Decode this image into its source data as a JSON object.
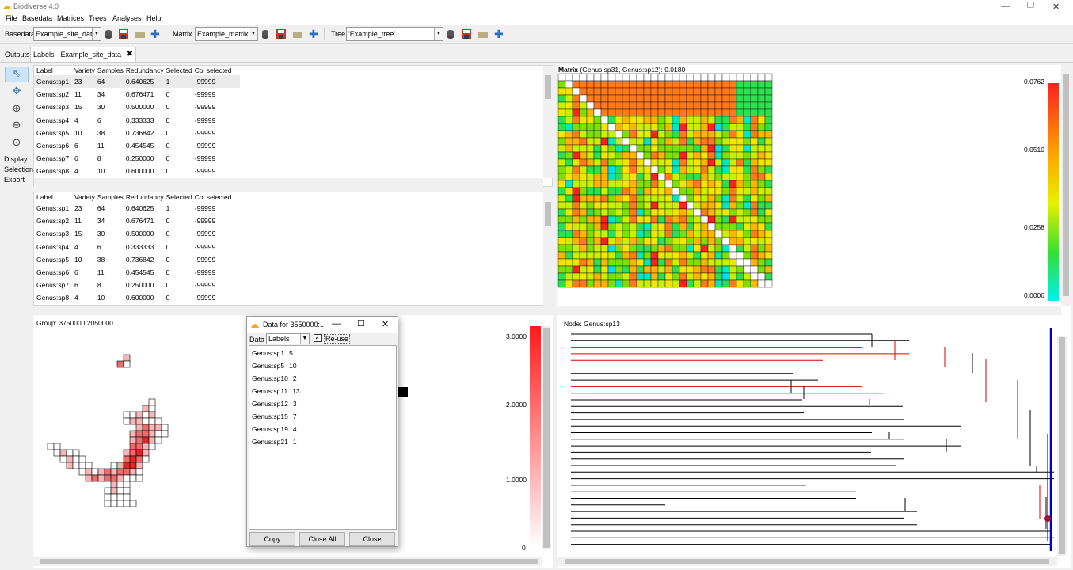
{
  "app": {
    "title": "Biodiverse 4.0"
  },
  "menu": [
    "File",
    "Basedata",
    "Matrices",
    "Trees",
    "Analyses",
    "Help"
  ],
  "toolbar": {
    "basedata_label": "Basedata",
    "basedata_value": "Example_site_data",
    "matrix_label": "Matrix",
    "matrix_value": "Example_matrix",
    "tree_label": "Tree",
    "tree_value": "'Example_tree'"
  },
  "tabs": [
    "Outputs",
    "Labels - Example_site_data"
  ],
  "sidebar": {
    "display": "Display",
    "selection": "Selection",
    "export": "Export"
  },
  "labels_table": {
    "columns": [
      "Label",
      "Variety",
      "Samples",
      "Redundancy",
      "Selected",
      "Col selected"
    ],
    "rows": [
      [
        "Genus:sp1",
        "23",
        "64",
        "0.640625",
        "1",
        "-99999"
      ],
      [
        "Genus:sp2",
        "11",
        "34",
        "0.676471",
        "0",
        "-99999"
      ],
      [
        "Genus:sp3",
        "15",
        "30",
        "0.500000",
        "0",
        "-99999"
      ],
      [
        "Genus:sp4",
        "4",
        "6",
        "0.333333",
        "0",
        "-99999"
      ],
      [
        "Genus:sp5",
        "10",
        "38",
        "0.736842",
        "0",
        "-99999"
      ],
      [
        "Genus:sp6",
        "6",
        "11",
        "0.454545",
        "0",
        "-99999"
      ],
      [
        "Genus:sp7",
        "6",
        "8",
        "0.250000",
        "0",
        "-99999"
      ],
      [
        "Genus:sp8",
        "4",
        "10",
        "0.600000",
        "0",
        "-99999"
      ]
    ]
  },
  "matrix": {
    "title": "Matrix",
    "caption": "(Genus:sp31, Genus:sp12): 0.0180",
    "legend": [
      "0.0762",
      "0.0510",
      "0.0258",
      "0.0006"
    ]
  },
  "map": {
    "group": "Group: 3750000:2050000",
    "legend": [
      "3.0000",
      "2.0000",
      "1.0000",
      "0"
    ]
  },
  "tree": {
    "node": "Node: Genus:sp13"
  },
  "popup": {
    "title": "Data for 3550000:...",
    "data_label": "Data",
    "data_value": "Labels",
    "reuse": "Re-use",
    "items": [
      {
        "name": "Genus:sp1",
        "count": "5"
      },
      {
        "name": "Genus:sp5",
        "count": "10"
      },
      {
        "name": "Genus:sp10",
        "count": "2"
      },
      {
        "name": "Genus:sp11",
        "count": "13"
      },
      {
        "name": "Genus:sp12",
        "count": "3"
      },
      {
        "name": "Genus:sp15",
        "count": "7"
      },
      {
        "name": "Genus:sp19",
        "count": "4"
      },
      {
        "name": "Genus:sp21",
        "count": "1"
      }
    ],
    "copy": "Copy",
    "close_all": "Close All",
    "close": "Close"
  },
  "colors": {
    "accent": "#0000cc",
    "tree_highlight": "#e00000",
    "arrow": "#000000"
  }
}
